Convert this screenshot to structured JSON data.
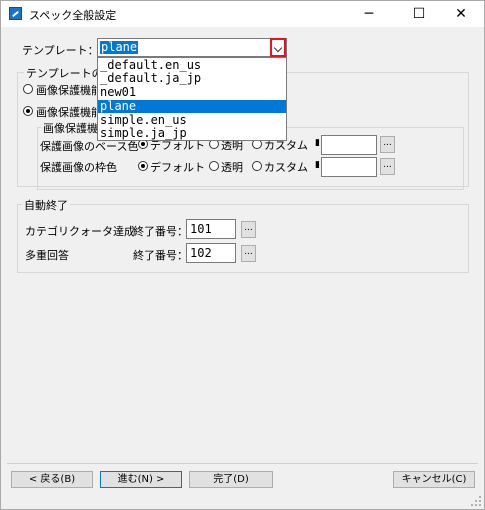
{
  "window": {
    "title": "スペック全般設定",
    "min": "─",
    "max": "☐",
    "close": "✕"
  },
  "template": {
    "label": "テンプレート：",
    "selected": "plane",
    "options": [
      "_default.en_us",
      "_default.ja_jp",
      "new01",
      "plane",
      "simple.en_us",
      "simple.ja_jp"
    ],
    "section_label": "テンプレートの",
    "radio1": "画像保護機能",
    "radio2": "画像保護機能",
    "subgroup_label": "画像保護機能"
  },
  "protection": {
    "base_color_label": "保護画像のベース色",
    "frame_color_label": "保護画像の枠色",
    "opt_default": "デフォルト",
    "opt_transparent": "透明",
    "opt_custom": "カスタム",
    "ellipsis": "..."
  },
  "auto_end": {
    "group_label": "自動終了",
    "row1_label": "カテゴリクォータ達成",
    "row1_num_label": "終了番号：",
    "row1_value": "101",
    "row2_label": "多重回答",
    "row2_num_label": "終了番号：",
    "row2_value": "102",
    "ellipsis": "..."
  },
  "footer": {
    "back": "< 戻る(B)",
    "next": "進む(N) >",
    "finish": "完了(D)",
    "cancel": "キャンセル(C)"
  }
}
